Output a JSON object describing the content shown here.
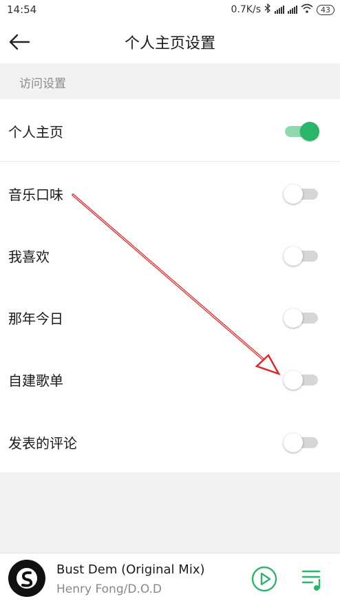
{
  "status": {
    "time": "14:54",
    "speed": "0.7K/s",
    "battery": "43"
  },
  "header": {
    "title": "个人主页设置"
  },
  "section": {
    "title": "访问设置"
  },
  "settings": [
    {
      "label": "个人主页",
      "state": "on"
    },
    {
      "label": "音乐口味",
      "state": "off"
    },
    {
      "label": "我喜欢",
      "state": "off"
    },
    {
      "label": "那年今日",
      "state": "off"
    },
    {
      "label": "自建歌单",
      "state": "off"
    },
    {
      "label": "发表的评论",
      "state": "off"
    }
  ],
  "player": {
    "title": "Bust Dem (Original Mix)",
    "artist": "Henry Fong/D.O.D"
  },
  "colors": {
    "accent_green": "#2bb56a",
    "accent_green_light": "#8fd8b0",
    "arrow_red": "#d42a2a",
    "toggle_off": "#d6d6d6"
  },
  "icons": [
    "back-arrow-icon",
    "bluetooth-icon",
    "signal-icon",
    "wifi-icon",
    "battery-icon",
    "play-icon",
    "playlist-icon"
  ]
}
